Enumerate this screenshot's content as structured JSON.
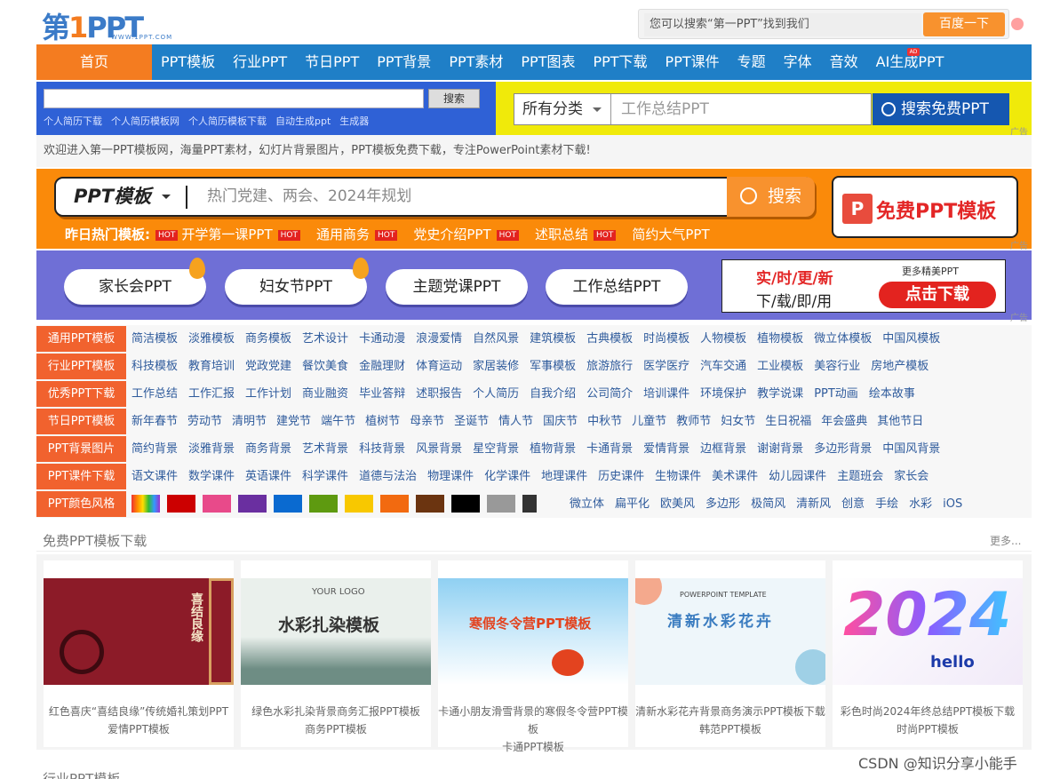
{
  "header": {
    "logo_main": "第1PPT",
    "logo_sub": "WWW.1PPT.COM",
    "search_placeholder": "您可以搜索“第一PPT”找到我们",
    "search_button": "百度一下"
  },
  "nav": {
    "home": "首页",
    "items": [
      "PPT模板",
      "行业PPT",
      "节日PPT",
      "PPT背景",
      "PPT素材",
      "PPT图表",
      "PPT下载",
      "PPT课件",
      "专题",
      "字体",
      "音效",
      "AI生成PPT"
    ],
    "ai_badge": "AD"
  },
  "search_left": {
    "button": "搜索",
    "hints": [
      "个人简历下载",
      "个人简历模板网",
      "个人简历模板下载",
      "自动生成ppt",
      "生成器"
    ]
  },
  "search_right": {
    "category": "所有分类",
    "placeholder": "工作总结PPT",
    "button": "搜索免费PPT",
    "ad": "广告"
  },
  "welcome": "欢迎进入第一PPT模板网，海量PPT素材，幻灯片背景图片，PPT模板免费下载，专注PowerPoint素材下载!",
  "orange": {
    "select": "PPT模板",
    "placeholder": "热门党建、两会、2024年规划",
    "button": "搜索",
    "banner": "免费PPT模板",
    "banner_icon": "P",
    "hot_label": "昨日热门模板:",
    "hot_tag": "HOT",
    "hot": [
      "开学第一课PPT",
      "通用商务",
      "党史介绍PPT",
      "述职总结",
      "简约大气PPT"
    ],
    "ad": "广告"
  },
  "purple": {
    "pills": [
      "家长会PPT",
      "妇女节PPT",
      "主题党课PPT",
      "工作总结PPT"
    ],
    "ad_line1": "实/时/更/新",
    "ad_line2": "下/载/即/用",
    "ad_more": "更多精美PPT",
    "ad_button": "点击下载",
    "ad": "广告"
  },
  "categories": [
    {
      "label": "通用PPT模板",
      "links": [
        "简洁模板",
        "淡雅模板",
        "商务模板",
        "艺术设计",
        "卡通动漫",
        "浪漫爱情",
        "自然风景",
        "建筑模板",
        "古典模板",
        "时尚模板",
        "人物模板",
        "植物模板",
        "微立体模板",
        "中国风模板"
      ]
    },
    {
      "label": "行业PPT模板",
      "links": [
        "科技模板",
        "教育培训",
        "党政党建",
        "餐饮美食",
        "金融理财",
        "体育运动",
        "家居装修",
        "军事模板",
        "旅游旅行",
        "医学医疗",
        "汽车交通",
        "工业模板",
        "美容行业",
        "房地产模板"
      ]
    },
    {
      "label": "优秀PPT下载",
      "links": [
        "工作总结",
        "工作汇报",
        "工作计划",
        "商业融资",
        "毕业答辩",
        "述职报告",
        "个人简历",
        "自我介绍",
        "公司简介",
        "培训课件",
        "环境保护",
        "教学说课",
        "PPT动画",
        "绘本故事"
      ]
    },
    {
      "label": "节日PPT模板",
      "links": [
        "新年春节",
        "劳动节",
        "清明节",
        "建党节",
        "端午节",
        "植树节",
        "母亲节",
        "圣诞节",
        "情人节",
        "国庆节",
        "中秋节",
        "儿童节",
        "教师节",
        "妇女节",
        "生日祝福",
        "年会盛典",
        "其他节日"
      ]
    },
    {
      "label": "PPT背景图片",
      "links": [
        "简约背景",
        "淡雅背景",
        "商务背景",
        "艺术背景",
        "科技背景",
        "风景背景",
        "星空背景",
        "植物背景",
        "卡通背景",
        "爱情背景",
        "边框背景",
        "谢谢背景",
        "多边形背景",
        "中国风背景"
      ]
    },
    {
      "label": "PPT课件下载",
      "links": [
        "语文课件",
        "数学课件",
        "英语课件",
        "科学课件",
        "道德与法治",
        "物理课件",
        "化学课件",
        "地理课件",
        "历史课件",
        "生物课件",
        "美术课件",
        "幼儿园课件",
        "主题班会",
        "家长会"
      ]
    },
    {
      "label": "PPT颜色风格",
      "links": [
        "微立体",
        "扁平化",
        "欧美风",
        "多边形",
        "极简风",
        "清新风",
        "创意",
        "手绘",
        "水彩",
        "iOS"
      ]
    }
  ],
  "colors": [
    "#cc0000",
    "#e84a8a",
    "#6a2fa0",
    "#0a6ad0",
    "#5e9a10",
    "#f8c800",
    "#f26a10",
    "#6b3410",
    "#000000",
    "#999999",
    "#333333"
  ],
  "free": {
    "title": "免费PPT模板下载",
    "more": "更多...",
    "cards": [
      {
        "img_text": "喜结良缘",
        "caption_1": "红色喜庆“喜结良缘”传统婚礼策划PPT",
        "caption_2": "爱情PPT模板"
      },
      {
        "img_text": "水彩扎染模板",
        "img_logo": "YOUR LOGO",
        "caption_1": "绿色水彩扎染背景商务汇报PPT模板",
        "caption_2": "商务PPT模板"
      },
      {
        "img_text": "寒假冬令营PPT模板",
        "caption_1": "卡通小朋友滑雪背景的寒假冬令营PPT模板",
        "caption_2": "卡通PPT模板"
      },
      {
        "img_text": "清新水彩花卉",
        "img_top": "POWERPOINT TEMPLATE",
        "caption_1": "清新水彩花卉背景商务演示PPT模板下载",
        "caption_2": "韩范PPT模板"
      },
      {
        "img_text": "2024",
        "img_sub": "hello",
        "caption_1": "彩色时尚2024年终总结PPT模板下载",
        "caption_2": "时尚PPT模板"
      }
    ]
  },
  "section2_title": "行业PPT模板",
  "watermark": "CSDN @知识分享小能手"
}
